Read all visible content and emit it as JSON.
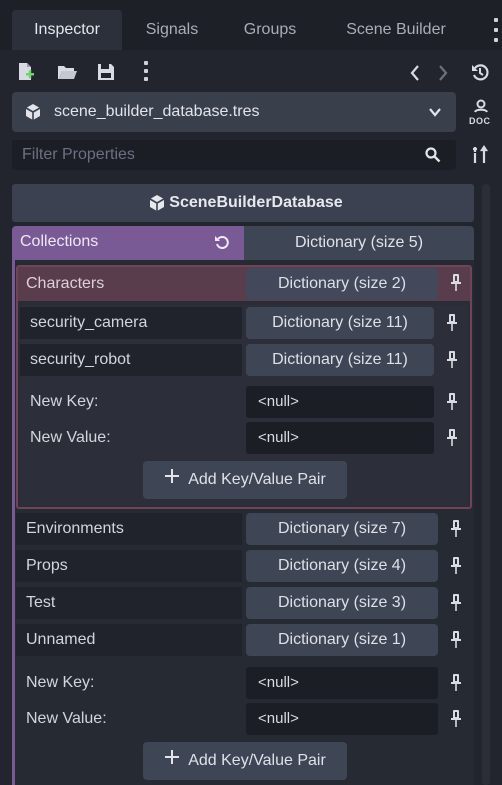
{
  "tabs": [
    {
      "label": "Inspector",
      "active": true
    },
    {
      "label": "Signals",
      "active": false
    },
    {
      "label": "Groups",
      "active": false
    },
    {
      "label": "Scene Builder",
      "active": false
    }
  ],
  "toolbar": {
    "icons": [
      "new-resource-icon",
      "open-folder-icon",
      "save-icon",
      "more-options-icon",
      "back-arrow-icon",
      "forward-arrow-icon",
      "history-icon"
    ]
  },
  "resource": {
    "name": "scene_builder_database.tres",
    "doc_label": "DOC"
  },
  "filter": {
    "placeholder": "Filter Properties"
  },
  "section": {
    "title": "SceneBuilderDatabase"
  },
  "collections": {
    "label": "Collections",
    "value": "Dictionary (size 5)",
    "characters": {
      "label": "Characters",
      "value": "Dictionary (size 2)",
      "entries": [
        {
          "key": "security_camera",
          "value": "Dictionary (size 11)"
        },
        {
          "key": "security_robot",
          "value": "Dictionary (size 11)"
        }
      ],
      "new_key_label": "New Key:",
      "new_key_value": "<null>",
      "new_value_label": "New Value:",
      "new_value_value": "<null>",
      "add_label": "Add Key/Value Pair"
    },
    "entries": [
      {
        "key": "Environments",
        "value": "Dictionary (size 7)"
      },
      {
        "key": "Props",
        "value": "Dictionary (size 4)"
      },
      {
        "key": "Test",
        "value": "Dictionary (size 3)"
      },
      {
        "key": "Unnamed",
        "value": "Dictionary (size 1)"
      }
    ],
    "new_key_label": "New Key:",
    "new_key_value": "<null>",
    "new_value_label": "New Value:",
    "new_value_value": "<null>",
    "add_label": "Add Key/Value Pair"
  },
  "colors": {
    "accent_purple": "#7a5a95",
    "characters_pink": "#6e4458",
    "panel_bg": "#22252e"
  }
}
